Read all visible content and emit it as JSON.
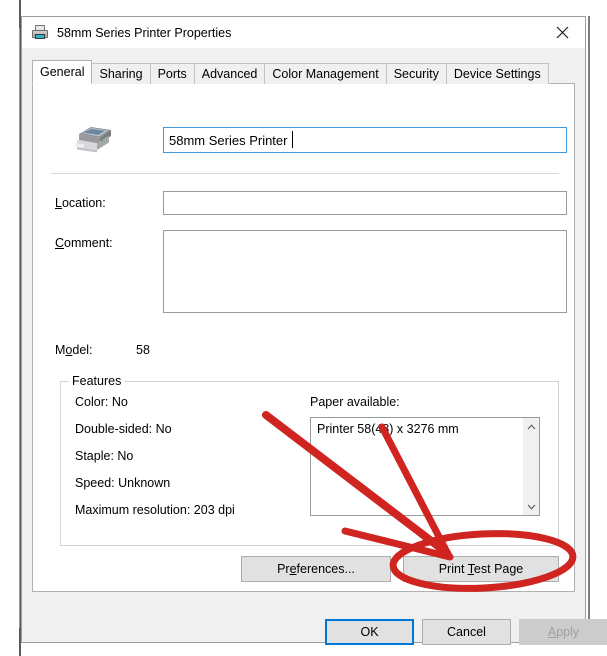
{
  "window": {
    "title": "58mm Series Printer Properties",
    "title_icon": "printer-icon",
    "close_label": "✕"
  },
  "tabs": [
    {
      "label": "General",
      "active": true
    },
    {
      "label": "Sharing",
      "active": false
    },
    {
      "label": "Ports",
      "active": false
    },
    {
      "label": "Advanced",
      "active": false
    },
    {
      "label": "Color Management",
      "active": false
    },
    {
      "label": "Security",
      "active": false
    },
    {
      "label": "Device Settings",
      "active": false
    }
  ],
  "general": {
    "printer_icon": "printer-large-icon",
    "name_value": "58mm Series Printer",
    "name_placeholder": "",
    "location_label_prefix": "L",
    "location_label_rest": "ocation:",
    "location_value": "",
    "location_placeholder": "",
    "comment_label_prefix": "C",
    "comment_label_rest": "omment:",
    "comment_value": "",
    "comment_placeholder": "",
    "model_label_pre": "M",
    "model_label_accel": "o",
    "model_label_post": "del:",
    "model_value": "58"
  },
  "features": {
    "legend": "Features",
    "lines": [
      "Color: No",
      "Double-sided: No",
      "Staple: No",
      "Speed: Unknown",
      "Maximum resolution: 203 dpi"
    ],
    "paper_label": "Paper available:",
    "paper_items": [
      "Printer 58(48) x 3276 mm"
    ],
    "scroll_up_icon": "chevron-up-icon",
    "scroll_down_icon": "chevron-down-icon"
  },
  "actions": {
    "preferences_pre": "Pr",
    "preferences_accel": "e",
    "preferences_post": "ferences...",
    "print_test_pre": "Print ",
    "print_test_accel": "T",
    "print_test_post": "est Page"
  },
  "footer": {
    "ok_label": "OK",
    "cancel_label": "Cancel",
    "apply_pre": "",
    "apply_accel": "A",
    "apply_post": "pply",
    "apply_disabled": true
  },
  "annotation": {
    "color": "#cf2420",
    "arrow_description": "red arrow pointing to Print Test Page button",
    "circle_description": "red ellipse circling Print Test Page button"
  }
}
